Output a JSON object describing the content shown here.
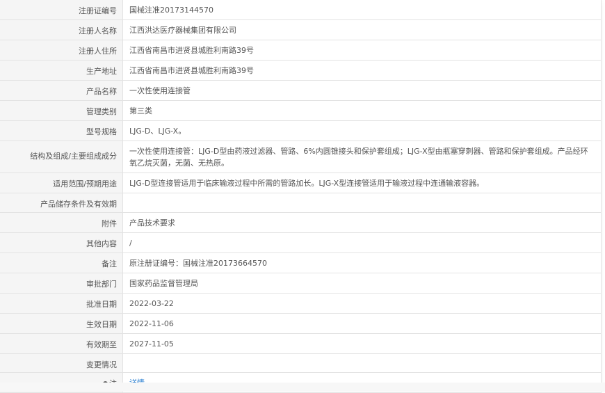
{
  "rows": [
    {
      "label": "注册证编号",
      "value": "国械注准20173144570"
    },
    {
      "label": "注册人名称",
      "value": "江西洪达医疗器械集团有限公司"
    },
    {
      "label": "注册人住所",
      "value": "江西省南昌市进贤县城胜利南路39号"
    },
    {
      "label": "生产地址",
      "value": "江西省南昌市进贤县城胜利南路39号"
    },
    {
      "label": "产品名称",
      "value": "一次性使用连接管"
    },
    {
      "label": "管理类别",
      "value": "第三类"
    },
    {
      "label": "型号规格",
      "value": "LJG-D、LJG-X。"
    },
    {
      "label": "结构及组成/主要组成成分",
      "value": "一次性使用连接管：LJG-D型由药液过滤器、管路、6%内圆锥接头和保护套组成；LJG-X型由瓶塞穿刺器、管路和保护套组成。产品经环氧乙烷灭菌，无菌、无热原。"
    },
    {
      "label": "适用范围/预期用途",
      "value": "LJG-D型连接管适用于临床输液过程中所需的管路加长。LJG-X型连接管适用于输液过程中连通输液容器。"
    },
    {
      "label": "产品储存条件及有效期",
      "value": ""
    },
    {
      "label": "附件",
      "value": "产品技术要求"
    },
    {
      "label": "其他内容",
      "value": "/"
    },
    {
      "label": "备注",
      "value": "原注册证编号：国械注准20173664570"
    },
    {
      "label": "审批部门",
      "value": "国家药品监督管理局"
    },
    {
      "label": "批准日期",
      "value": "2022-03-22"
    },
    {
      "label": "生效日期",
      "value": "2022-11-06"
    },
    {
      "label": "有效期至",
      "value": "2027-11-05"
    },
    {
      "label": "变更情况",
      "value": ""
    }
  ],
  "note_row": {
    "label": "注",
    "link_text": "详情",
    "icon": "pin-icon"
  },
  "colors": {
    "link": "#2a7fd1",
    "label_bg": "#f5f5f5",
    "border": "#e3e3e3"
  }
}
